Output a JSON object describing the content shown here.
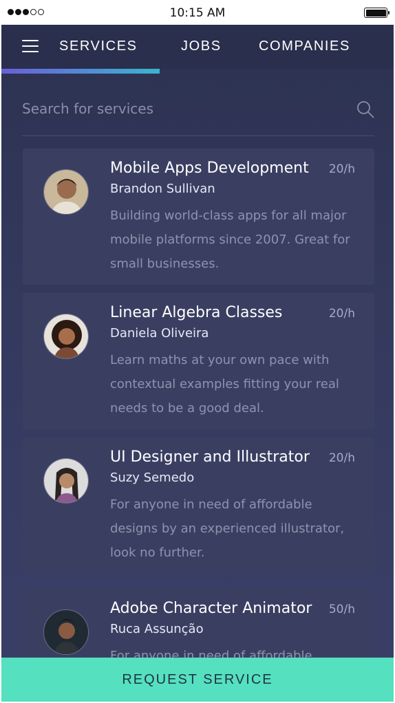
{
  "status_bar": {
    "time": "10:15 AM"
  },
  "nav": {
    "tabs": [
      {
        "label": "SERVICES",
        "active": true
      },
      {
        "label": "JOBS",
        "active": false
      },
      {
        "label": "COMPANIES",
        "active": false
      }
    ]
  },
  "search": {
    "placeholder": "Search for services",
    "value": ""
  },
  "services": [
    {
      "title": "Mobile Apps Development",
      "rate": "20/h",
      "author": "Brandon Sullivan",
      "description": "Building world-class apps for all major mobile platforms since 2007. Great for small businesses."
    },
    {
      "title": "Linear Algebra Classes",
      "rate": "20/h",
      "author": "Daniela Oliveira",
      "description": "Learn maths at your own pace with contextual examples fitting your real needs to be a good deal."
    },
    {
      "title": "UI Designer and Illustrator",
      "rate": "20/h",
      "author": "Suzy Semedo",
      "description": "For anyone in need of affordable designs by an experienced illustrator, look no further."
    },
    {
      "title": "Adobe Character Animator",
      "rate": "50/h",
      "author": "Ruca Assunção",
      "description": "For anyone in need of affordable"
    }
  ],
  "cta": {
    "label": "REQUEST SERVICE"
  },
  "colors": {
    "accent": "#55e0c0",
    "indicator_start": "#6a5fd8",
    "indicator_end": "#3bb4cf",
    "background": "#2c3150",
    "card": "#3a3f62"
  }
}
